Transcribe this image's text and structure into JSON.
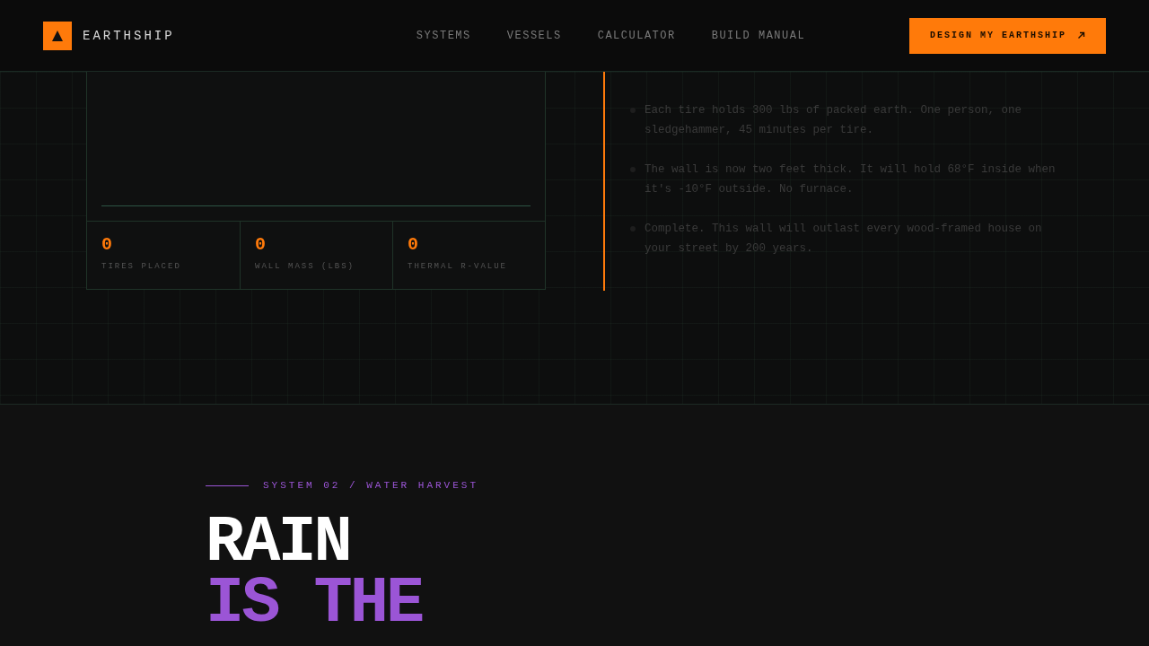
{
  "header": {
    "brand": "EARTHSHIP",
    "nav": [
      {
        "label": "SYSTEMS"
      },
      {
        "label": "VESSELS"
      },
      {
        "label": "CALCULATOR"
      },
      {
        "label": "BUILD MANUAL"
      }
    ],
    "cta": "DESIGN MY EARTHSHIP"
  },
  "wall_builder": {
    "stats": [
      {
        "value": "0",
        "label": "TIRES PLACED"
      },
      {
        "value": "0",
        "label": "WALL MASS (LBS)"
      },
      {
        "value": "0",
        "label": "THERMAL R-VALUE"
      }
    ],
    "steps": [
      {
        "text": "Each tire holds 300 lbs of packed earth. One person, one sledgehammer, 45 minutes per tire."
      },
      {
        "text": "The wall is now two feet thick. It will hold 68°F inside when it's -10°F outside. No furnace."
      },
      {
        "text": "Complete. This wall will outlast every wood-framed house on your street by 200 years."
      }
    ]
  },
  "water_section": {
    "eyebrow": "SYSTEM 02 / WATER HARVEST",
    "heading": [
      {
        "text": "RAIN",
        "accent": false
      },
      {
        "text": "IS THE",
        "accent": true
      }
    ]
  }
}
